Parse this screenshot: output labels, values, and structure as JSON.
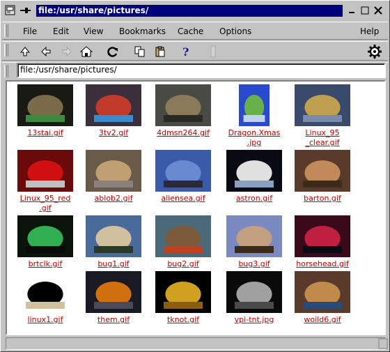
{
  "window": {
    "title": "file:/usr/share/pictures/"
  },
  "menubar": {
    "items": [
      "File",
      "Edit",
      "View",
      "Bookmarks",
      "Cache",
      "Options",
      "Help"
    ]
  },
  "toolbar": {
    "buttons": [
      "up-icon",
      "back-icon",
      "forward-icon",
      "home-icon",
      "reload-icon",
      "copy-icon",
      "paste-icon",
      "help-icon",
      "stop-icon"
    ]
  },
  "location": {
    "value": "file:/usr/share/pictures/"
  },
  "files": [
    {
      "name": "13stai.gif",
      "colors": [
        "#1a1a14",
        "#7a6b4a",
        "#3c8a3c"
      ]
    },
    {
      "name": "3tv2.gif",
      "colors": [
        "#3a2f3a",
        "#c23b2a",
        "#3a8acd"
      ]
    },
    {
      "name": "4dmsn264.gif",
      "colors": [
        "#4a4a44",
        "#8a7a5a",
        "#2a2a24"
      ]
    },
    {
      "name": "Dragon.Xmas\n.jpg",
      "colors": [
        "#2a4acd",
        "#6ab04a",
        "#c0d0f0"
      ]
    },
    {
      "name": "Linux_95\n_clear.gif",
      "colors": [
        "#3a4a6a",
        "#c0a050",
        "#7a8aaa"
      ]
    },
    {
      "name": "Linux_95_red\n.gif",
      "colors": [
        "#6a0a0a",
        "#d01010",
        "#c0c0c0"
      ]
    },
    {
      "name": "ablob2.gif",
      "colors": [
        "#6a5a4a",
        "#c0a070",
        "#8a8080"
      ]
    },
    {
      "name": "aliensea.gif",
      "colors": [
        "#3a5aaa",
        "#6a8ad0",
        "#2a2a3a"
      ]
    },
    {
      "name": "astron.gif",
      "colors": [
        "#0a0a14",
        "#e0e0e0",
        "#8aa0c0"
      ]
    },
    {
      "name": "barton.gif",
      "colors": [
        "#5a3a2a",
        "#c08a5a",
        "#3a2a1a"
      ]
    },
    {
      "name": "brtclk.gif",
      "colors": [
        "#0a140a",
        "#30b050",
        "#0a0a0a"
      ]
    },
    {
      "name": "bug1.gif",
      "colors": [
        "#4a6a9a",
        "#d0c0a0",
        "#2a3a2a"
      ]
    },
    {
      "name": "bug2.gif",
      "colors": [
        "#4a6a7a",
        "#7a5a3a",
        "#c04020"
      ]
    },
    {
      "name": "bug3.gif",
      "colors": [
        "#7a8ac0",
        "#c0a080",
        "#3a2a1a"
      ]
    },
    {
      "name": "horsehead.gif",
      "colors": [
        "#3a0a1a",
        "#c02040",
        "#0a0a14"
      ]
    },
    {
      "name": "linux1.gif",
      "colors": [
        "#ffffff",
        "#000000",
        "#d0c0a0"
      ]
    },
    {
      "name": "them.gif",
      "colors": [
        "#1a1a24",
        "#d07010",
        "#4a4a5a"
      ]
    },
    {
      "name": "tknot.gif",
      "colors": [
        "#000000",
        "#d0a020",
        "#8a6010"
      ]
    },
    {
      "name": "vpi-tnt.jpg",
      "colors": [
        "#0a0a0a",
        "#a0a0a0",
        "#4a4a4a"
      ]
    },
    {
      "name": "woild6.gif",
      "colors": [
        "#5a3a2a",
        "#c08a4a",
        "#2a4a7a"
      ]
    }
  ]
}
